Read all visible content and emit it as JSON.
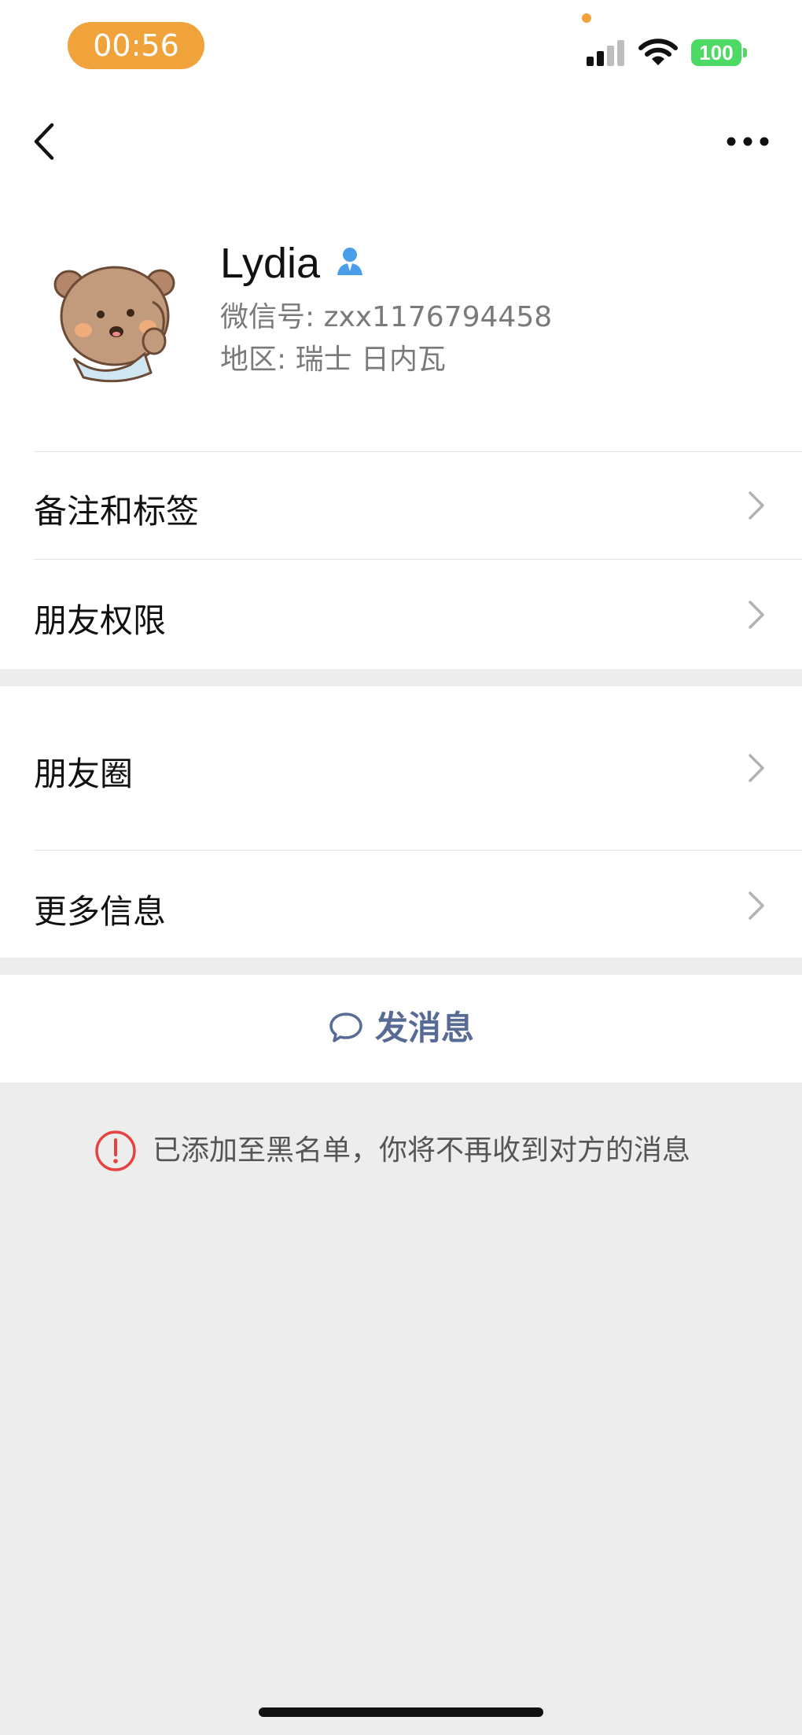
{
  "status_bar": {
    "time": "00:56",
    "battery": "100",
    "pill_color": "#f0a23b",
    "battery_color": "#4cd964"
  },
  "nav": {
    "back_icon": "chevron-left-icon",
    "more_icon": "ellipsis-icon"
  },
  "profile": {
    "name": "Lydia",
    "wechat_id": "微信号: zxx1176794458",
    "region": "地区: 瑞士 日内瓦",
    "badge_icon": "person-icon"
  },
  "menu": {
    "remarks_tags": "备注和标签",
    "friend_permissions": "朋友权限",
    "moments": "朋友圈",
    "more_info": "更多信息"
  },
  "actions": {
    "send_message": "发消息",
    "send_color": "#576b95"
  },
  "notice": {
    "text": "已添加至黑名单，你将不再收到对方的消息",
    "icon_color": "#e64340"
  }
}
